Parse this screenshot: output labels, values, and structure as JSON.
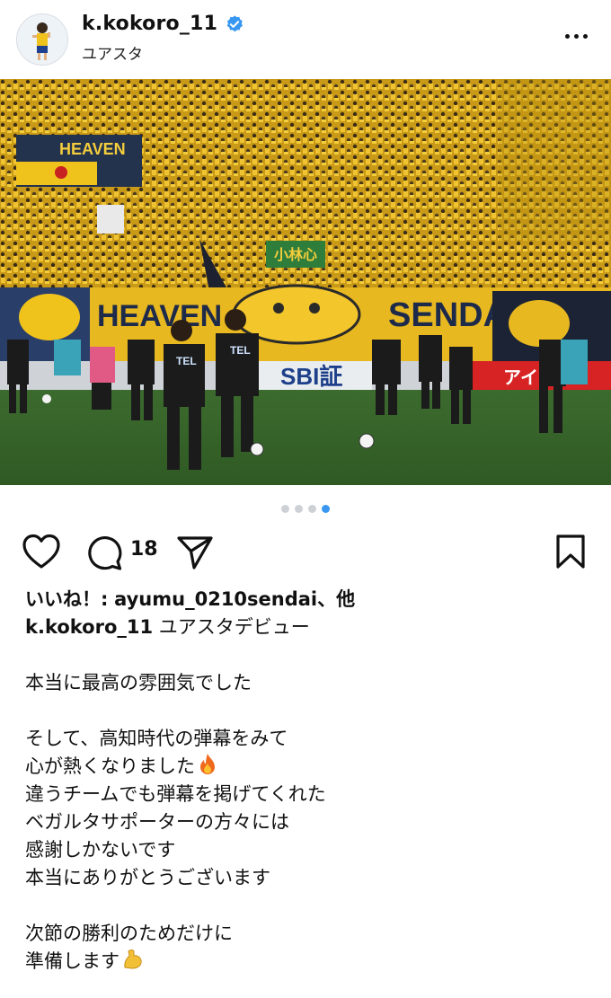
{
  "post": {
    "username": "k.kokoro_11",
    "location": "ユアスタ",
    "verified": true,
    "carousel": {
      "count": 4,
      "active": 4
    },
    "comment_count": "18",
    "likes_label": "いいね！:",
    "likes_user": "ayumu_0210sendai",
    "likes_suffix": "、他",
    "caption_title": "ユアスタデビュー",
    "caption": {
      "l1": "本当に最高の雰囲気でした",
      "l2": "そして、高知時代の弾幕をみて",
      "l3": "心が熱くなりました",
      "l4": "違うチームでも弾幕を掲げてくれた",
      "l5": "ベガルタサポーターの方々には",
      "l6": "感謝しかないです",
      "l7": "本当にありがとうございます",
      "l8": "次節の勝利のためだけに",
      "l9": "準備します"
    }
  },
  "photo_signage": {
    "banner_left": "HEAVEN",
    "banner_center": "SENDAI",
    "sponsor1": "SBI証",
    "sponsor2": "アイリ",
    "flag": "小林心",
    "shirt": "TEL"
  },
  "colors": {
    "accent": "#3897f0",
    "verified": "#3897f0",
    "crowd": "#d9a81c",
    "pitch": "#3d6b2f"
  }
}
